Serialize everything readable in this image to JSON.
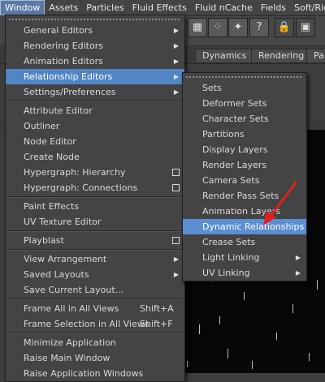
{
  "menubar": [
    "Window",
    "Assets",
    "Particles",
    "Fluid Effects",
    "Fluid nCache",
    "Fields",
    "Soft/Rigi"
  ],
  "shelf_tabs": [
    "Dynamics",
    "Rendering",
    "Pa"
  ],
  "window_menu": {
    "items": [
      {
        "label": "General Editors",
        "type": "submenu"
      },
      {
        "label": "Rendering Editors",
        "type": "submenu"
      },
      {
        "label": "Animation Editors",
        "type": "submenu"
      },
      {
        "label": "Relationship Editors",
        "type": "submenu",
        "highlighted": true
      },
      {
        "label": "Settings/Preferences",
        "type": "submenu"
      },
      {
        "label": "Attribute Editor",
        "type": "item"
      },
      {
        "label": "Outliner",
        "type": "item"
      },
      {
        "label": "Node Editor",
        "type": "item"
      },
      {
        "label": "Create Node",
        "type": "item"
      },
      {
        "label": "Hypergraph: Hierarchy",
        "type": "option"
      },
      {
        "label": "Hypergraph: Connections",
        "type": "option"
      },
      {
        "label": "Paint Effects",
        "type": "item"
      },
      {
        "label": "UV Texture Editor",
        "type": "item"
      },
      {
        "label": "Playblast",
        "type": "option"
      },
      {
        "label": "View Arrangement",
        "type": "submenu"
      },
      {
        "label": "Saved Layouts",
        "type": "submenu"
      },
      {
        "label": "Save Current Layout...",
        "type": "item"
      },
      {
        "label": "Frame All in All Views",
        "type": "item",
        "shortcut": "Shift+A"
      },
      {
        "label": "Frame Selection in All Views",
        "type": "item",
        "shortcut": "Shift+F"
      },
      {
        "label": "Minimize Application",
        "type": "item"
      },
      {
        "label": "Raise Main Window",
        "type": "item"
      },
      {
        "label": "Raise Application Windows",
        "type": "item"
      }
    ]
  },
  "relationship_submenu": {
    "items": [
      {
        "label": "Sets",
        "type": "item"
      },
      {
        "label": "Deformer Sets",
        "type": "item"
      },
      {
        "label": "Character Sets",
        "type": "item"
      },
      {
        "label": "Partitions",
        "type": "item"
      },
      {
        "label": "Display Layers",
        "type": "item"
      },
      {
        "label": "Render Layers",
        "type": "item"
      },
      {
        "label": "Camera Sets",
        "type": "item"
      },
      {
        "label": "Render Pass Sets",
        "type": "item"
      },
      {
        "label": "Animation Layers",
        "type": "item"
      },
      {
        "label": "Dynamic Relationships",
        "type": "item",
        "highlighted": true
      },
      {
        "label": "Crease Sets",
        "type": "item"
      },
      {
        "label": "Light Linking",
        "type": "submenu"
      },
      {
        "label": "UV Linking",
        "type": "submenu"
      }
    ]
  },
  "colors": {
    "highlight": "#5285c4",
    "annotation_arrow": "#e02020"
  }
}
